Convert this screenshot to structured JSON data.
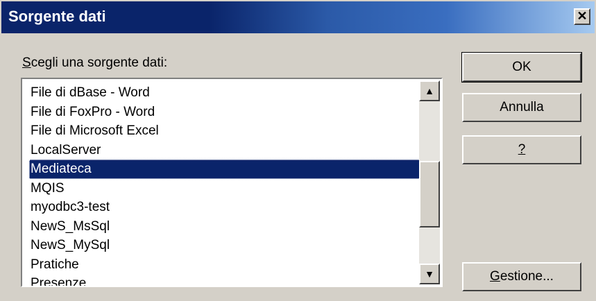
{
  "window": {
    "title": "Sorgente dati",
    "close_glyph": "✕"
  },
  "label": {
    "mnemonic": "S",
    "rest": "cegli una sorgente dati:"
  },
  "list": {
    "items": [
      "File di dBase - Word",
      "File di FoxPro - Word",
      "File di Microsoft Excel",
      "LocalServer",
      "Mediateca",
      "MQIS",
      "myodbc3-test",
      "NewS_MsSql",
      "NewS_MySql",
      "Pratiche",
      "Presenze"
    ],
    "selected": "Mediateca"
  },
  "scrollbar": {
    "up_glyph": "▲",
    "down_glyph": "▼"
  },
  "buttons": {
    "ok_label": "OK",
    "cancel_label": "Annulla",
    "help_label": "?",
    "manage_mnemonic": "G",
    "manage_rest": "estione..."
  },
  "colors": {
    "selection": "#0a246a",
    "face": "#d4d0c8"
  }
}
